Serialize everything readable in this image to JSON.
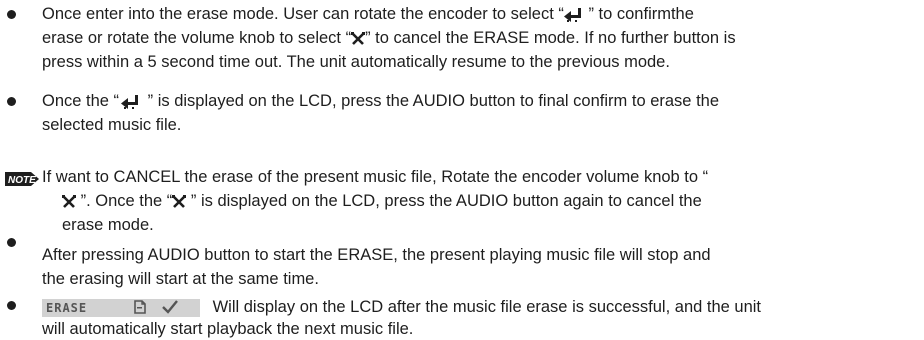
{
  "para1": {
    "l1a": "Once enter into the erase mode. User can rotate the encoder  to select “",
    "l1b": " ” to confirmthe",
    "l2a": "erase or rotate the volume knob to select “",
    "l2b": "” to cancel the ERASE mode. If no further button is",
    "l3": "press within a 5 second time out. The unit automatically resume to the previous mode."
  },
  "para2": {
    "l1a": "Once the “",
    "l1b": " ” is displayed on the LCD, press the AUDIO button to final confirm to erase the",
    "l2": "selected music file."
  },
  "note": {
    "badge": "NOTE",
    "l1": "If want to CANCEL the erase of the present music file, Rotate the encoder volume knob to “",
    "l2a": " ”.  Once the “",
    "l2b": " ” is displayed on the LCD, press the AUDIO button again to cancel the",
    "l3": "erase mode."
  },
  "para3": {
    "l1": "After pressing AUDIO button to start the ERASE, the present playing music file will stop and",
    "l2": "the erasing will start at the same time."
  },
  "para4": {
    "lcd_text": "ERASE",
    "l1": "Will display on the LCD after the music file erase is successful, and the unit",
    "l2": "will automatically start playback the next music file."
  },
  "icons": {
    "confirm": "enter-arrow-icon",
    "cancel": "cross-x-icon",
    "file": "file-icon",
    "check": "checkmark-icon"
  }
}
